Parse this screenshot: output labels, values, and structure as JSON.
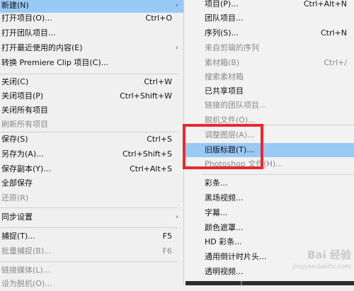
{
  "left_menu": {
    "items": [
      {
        "label": "新建(N)",
        "shortcut": "",
        "arrow": "›",
        "disabled": false,
        "highlight": true
      },
      {
        "label": "打开项目(O)...",
        "shortcut": "Ctrl+O",
        "arrow": "",
        "disabled": false
      },
      {
        "label": "打开团队项目...",
        "shortcut": "",
        "arrow": "",
        "disabled": false
      },
      {
        "label": "打开最近使用的内容(E)",
        "shortcut": "",
        "arrow": "›",
        "disabled": false
      },
      {
        "label": "转换 Premiere Clip 项目(C)...",
        "shortcut": "",
        "arrow": "",
        "disabled": false
      },
      {
        "label": "关闭(C)",
        "shortcut": "Ctrl+W",
        "arrow": "",
        "disabled": false
      },
      {
        "label": "关闭项目(P)",
        "shortcut": "Ctrl+Shift+W",
        "arrow": "",
        "disabled": false
      },
      {
        "label": "关闭所有项目",
        "shortcut": "",
        "arrow": "",
        "disabled": false
      },
      {
        "label": "刷新所有项目",
        "shortcut": "",
        "arrow": "",
        "disabled": true
      },
      {
        "label": "保存(S)",
        "shortcut": "Ctrl+S",
        "arrow": "",
        "disabled": false
      },
      {
        "label": "另存为(A)...",
        "shortcut": "Ctrl+Shift+S",
        "arrow": "",
        "disabled": false
      },
      {
        "label": "保存副本(Y)...",
        "shortcut": "Ctrl+Alt+S",
        "arrow": "",
        "disabled": false
      },
      {
        "label": "全部保存",
        "shortcut": "",
        "arrow": "",
        "disabled": false
      },
      {
        "label": "还原(R)",
        "shortcut": "",
        "arrow": "",
        "disabled": true
      },
      {
        "label": "同步设置",
        "shortcut": "",
        "arrow": "›",
        "disabled": false
      },
      {
        "label": "捕捉(T)...",
        "shortcut": "F5",
        "arrow": "",
        "disabled": false
      },
      {
        "label": "批量捕捉(B)...",
        "shortcut": "F6",
        "arrow": "",
        "disabled": true
      },
      {
        "label": "链接媒体(L)...",
        "shortcut": "",
        "arrow": "",
        "disabled": true
      },
      {
        "label": "设为脱机(O)...",
        "shortcut": "",
        "arrow": "",
        "disabled": true
      }
    ]
  },
  "sub_menu": {
    "items": [
      {
        "label": "项目(P)...",
        "shortcut": "Ctrl+Alt+N",
        "disabled": false
      },
      {
        "label": "团队项目...",
        "shortcut": "",
        "disabled": false
      },
      {
        "label": "序列(S)...",
        "shortcut": "Ctrl+N",
        "disabled": false
      },
      {
        "label": "来自剪辑的序列",
        "shortcut": "",
        "disabled": true
      },
      {
        "label": "素材箱(B)",
        "shortcut": "Ctrl+/",
        "disabled": true
      },
      {
        "label": "搜索素材箱",
        "shortcut": "",
        "disabled": true
      },
      {
        "label": "已共享项目",
        "shortcut": "",
        "disabled": false
      },
      {
        "label": "链接的团队项目...",
        "shortcut": "",
        "disabled": true
      },
      {
        "label": "脱机文件(O)...",
        "shortcut": "",
        "disabled": true
      },
      {
        "label": "调整图层(A)...",
        "shortcut": "",
        "disabled": true
      },
      {
        "label": "旧版标题(T)...",
        "shortcut": "",
        "disabled": false,
        "highlight": true
      },
      {
        "label": "Photoshop 文件(H)...",
        "shortcut": "",
        "disabled": true
      },
      {
        "label": "彩条...",
        "shortcut": "",
        "disabled": false
      },
      {
        "label": "黑场视频...",
        "shortcut": "",
        "disabled": false
      },
      {
        "label": "字幕...",
        "shortcut": "",
        "disabled": false
      },
      {
        "label": "颜色遮罩...",
        "shortcut": "",
        "disabled": false
      },
      {
        "label": "HD 彩条...",
        "shortcut": "",
        "disabled": false
      },
      {
        "label": "通用倒计时片头...",
        "shortcut": "",
        "disabled": false
      },
      {
        "label": "透明视频...",
        "shortcut": "",
        "disabled": false
      }
    ]
  },
  "watermark": {
    "line1": "Bai 经验",
    "line2": "jingyan.baidu.com"
  },
  "colors": {
    "highlight": "#99c9f5",
    "disabled": "#8a8a8a",
    "annotation_box": "#e8292c"
  }
}
